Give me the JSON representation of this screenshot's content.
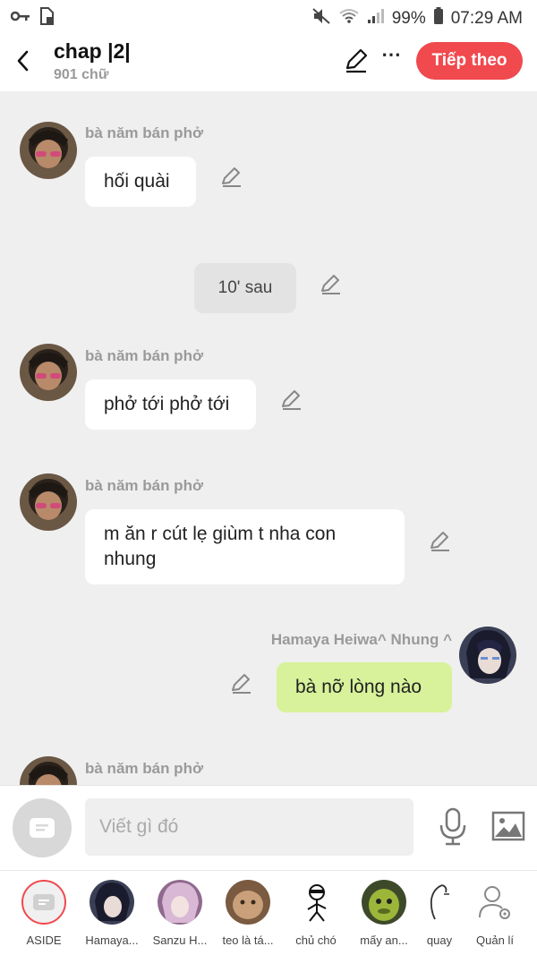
{
  "status_bar": {
    "battery": "99%",
    "time": "07:29 AM",
    "icons": [
      "key-icon",
      "sim-lock-icon",
      "mute-icon",
      "wifi-icon",
      "signal-icon",
      "battery-icon"
    ]
  },
  "header": {
    "title": "chap |2|",
    "subtitle": "901 chữ",
    "next_label": "Tiếp theo",
    "more_label": "⋯",
    "accent": "#f0494e"
  },
  "messages": [
    {
      "sender": "bà năm bán phở",
      "text": "hối quài",
      "kind": "received"
    },
    {
      "text": "10' sau",
      "kind": "narration"
    },
    {
      "sender": "bà năm bán phở",
      "text": "phở tới phở tới",
      "kind": "received"
    },
    {
      "sender": "bà năm bán phở",
      "text": "m ăn r cút lẹ giùm t nha con nhung",
      "kind": "received"
    },
    {
      "sender": "Hamaya Heiwa^ Nhung ^",
      "text": "bà nỡ lòng nào",
      "kind": "sent"
    },
    {
      "sender": "bà năm bán phở",
      "text": "",
      "kind": "received"
    }
  ],
  "input": {
    "placeholder": "Viết gì đó"
  },
  "characters": [
    {
      "label": "ASIDE"
    },
    {
      "label": "Hamaya..."
    },
    {
      "label": "Sanzu H..."
    },
    {
      "label": "teo là tá..."
    },
    {
      "label": "chủ chó"
    },
    {
      "label": "mấy an..."
    },
    {
      "label": "quay"
    },
    {
      "label": "Quản lí"
    }
  ],
  "colors": {
    "sent_bubble": "#d7f29a",
    "received_bubble": "#ffffff",
    "chat_background": "#efefef"
  }
}
